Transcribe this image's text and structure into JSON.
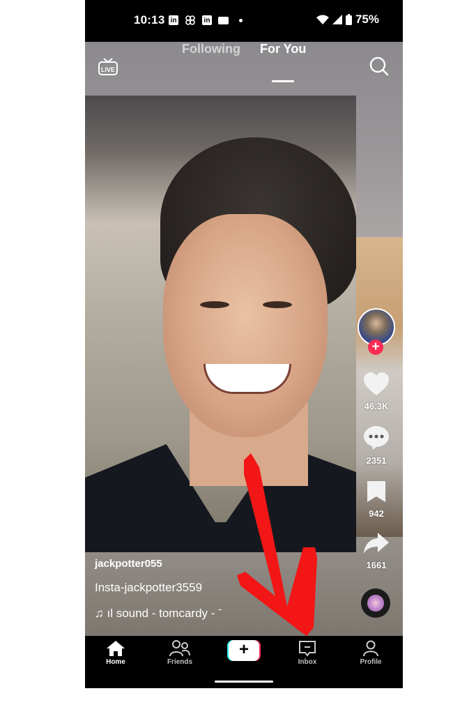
{
  "status_bar": {
    "time": "10:13",
    "notification_icons": [
      "linkedin-icon",
      "pinwheel-icon",
      "linkedin-icon",
      "gmail-icon"
    ],
    "battery": "75%"
  },
  "top_nav": {
    "live_label": "LIVE",
    "tabs": [
      {
        "label": "Following",
        "active": false
      },
      {
        "label": "For You",
        "active": true
      }
    ]
  },
  "actions": {
    "likes": "46.3K",
    "comments": "2351",
    "saves": "942",
    "shares": "1661",
    "follow_symbol": "+"
  },
  "caption": {
    "username": "jackpotter055",
    "description": "Insta-jackpotter3559",
    "sound": "ıl sound - tomcardy - ˉ",
    "sound_icon": "♫"
  },
  "bottom_nav": {
    "items": [
      {
        "label": "Home",
        "active": true
      },
      {
        "label": "Friends",
        "active": false
      },
      {
        "label": "Inbox",
        "active": false
      },
      {
        "label": "Profile",
        "active": false
      }
    ],
    "create_symbol": "+"
  },
  "colors": {
    "accent_red": "#fe2c55",
    "accent_cyan": "#25f4ee",
    "annotation_arrow": "#f21616"
  }
}
